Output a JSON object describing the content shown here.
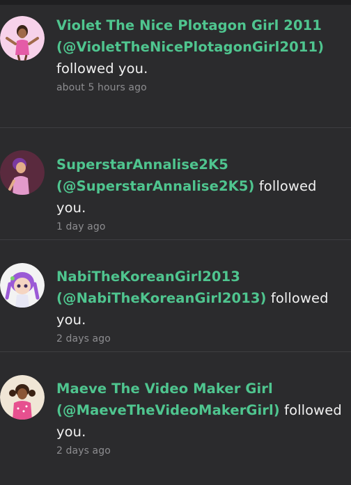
{
  "notifications": [
    {
      "display_name": "Violet The Nice Plotagon Girl 2011",
      "handle": "(@VioletTheNicePlotagonGirl2011)",
      "action": "followed you.",
      "time": "about 5 hours ago",
      "avatar_icon": "avatar-violet-icon"
    },
    {
      "display_name": "SuperstarAnnalise2K5",
      "handle": "(@SuperstarAnnalise2K5)",
      "action": "followed you.",
      "time": "1 day ago",
      "avatar_icon": "avatar-annalise-icon"
    },
    {
      "display_name": "NabiTheKoreanGirl2013",
      "handle": "(@NabiTheKoreanGirl2013)",
      "action": "followed you.",
      "time": "2 days ago",
      "avatar_icon": "avatar-nabi-icon"
    },
    {
      "display_name": "Maeve The Video Maker Girl",
      "handle": "(@MaeveTheVideoMakerGirl)",
      "action": "followed you.",
      "time": "2 days ago",
      "avatar_icon": "avatar-maeve-icon"
    }
  ],
  "colors": {
    "background": "#2b2b2d",
    "accent": "#4fc58f",
    "text": "#f1f1f1",
    "muted": "#8d8d90",
    "divider": "#3e3e41"
  }
}
